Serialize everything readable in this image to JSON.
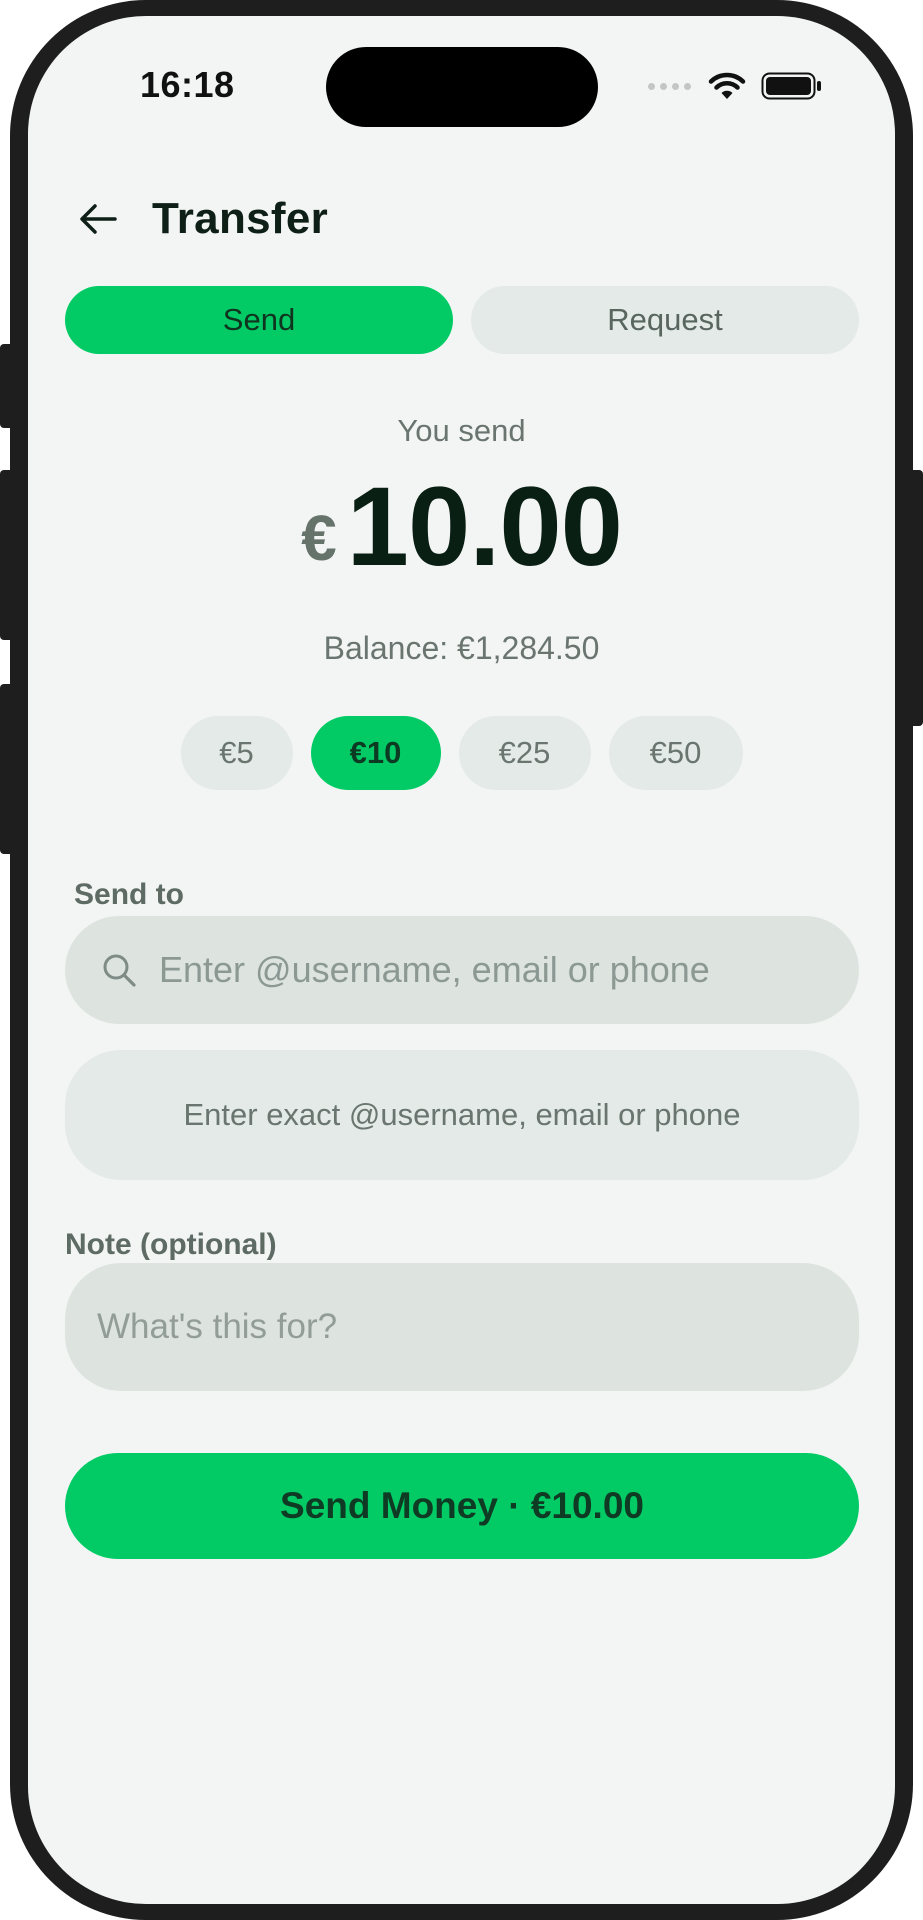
{
  "status_bar": {
    "time": "16:18"
  },
  "header": {
    "title": "Transfer"
  },
  "tabs": [
    {
      "label": "Send",
      "active": true
    },
    {
      "label": "Request",
      "active": false
    }
  ],
  "amount": {
    "caption": "You send",
    "currency_symbol": "€",
    "value": "10.00",
    "balance": "Balance: €1,284.50"
  },
  "quick_amounts": [
    {
      "label": "€5",
      "active": false
    },
    {
      "label": "€10",
      "active": true
    },
    {
      "label": "€25",
      "active": false
    },
    {
      "label": "€50",
      "active": false
    }
  ],
  "recipient": {
    "label": "Send to",
    "search_placeholder": "Enter @username, email or phone",
    "exact_hint": "Enter exact @username, email or phone"
  },
  "note": {
    "label": "Note (optional)",
    "placeholder": "What's this for?"
  },
  "submit": {
    "label": "Send Money · €10.00"
  },
  "colors": {
    "accent": "#02cb66",
    "background": "#f3f5f4",
    "chip_bg": "#e3eae7",
    "input_bg": "#dde4e0",
    "text_dark": "#0a1f14"
  },
  "icons": {
    "back": "arrow-left-icon",
    "search": "search-icon",
    "wifi": "wifi-icon",
    "battery": "battery-icon",
    "signal": "signal-icon"
  }
}
